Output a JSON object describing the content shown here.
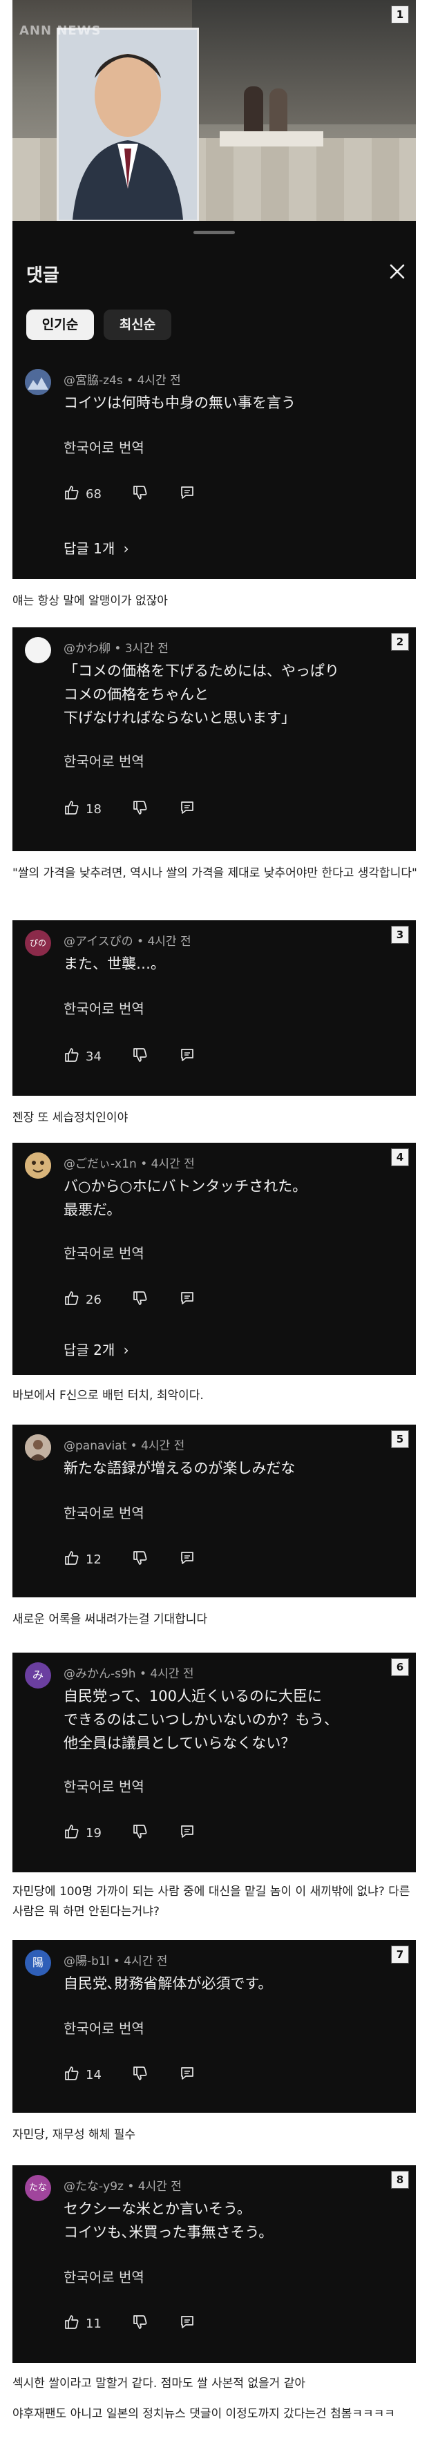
{
  "video": {
    "watermark": "ANN NEWS",
    "badge": "1"
  },
  "comments_panel": {
    "title": "댓글",
    "close_icon": "close-icon",
    "sort_tabs": [
      {
        "label": "인기순",
        "active": true
      },
      {
        "label": "최신순",
        "active": false
      }
    ]
  },
  "comments": [
    {
      "badge": "",
      "author": "@宮脇-z4s • 4시간 전",
      "text_lines": [
        "コイツは何時も中身の無い事を言う"
      ],
      "translate": "한국어로 번역",
      "likes": "68",
      "replies": "답글 1개",
      "caption": "얘는 항상 말에 알맹이가 없잖아"
    },
    {
      "badge": "2",
      "author": "@かわ柳 • 3시간 전",
      "text_lines": [
        "「コメの価格を下げるためには、やっぱり",
        "コメの価格をちゃんと",
        "下げなければならないと思います」"
      ],
      "translate": "한국어로 번역",
      "likes": "18",
      "replies": "",
      "caption": "\"쌀의 가격을 낮추려면, 역시나 쌀의 가격을 제대로 낮추어야만 한다고 생각합니다\""
    },
    {
      "badge": "3",
      "author": "@アイスぴの • 4시간 전",
      "text_lines": [
        "また、世襲…。"
      ],
      "translate": "한국어로 번역",
      "likes": "34",
      "replies": "",
      "caption": "젠장 또 세습정치인이야"
    },
    {
      "badge": "4",
      "author": "@ごだぃ-x1n • 4시간 전",
      "text_lines": [
        "バ○から○ホにバトンタッチされた。",
        "最悪だ。"
      ],
      "translate": "한국어로 번역",
      "likes": "26",
      "replies": "답글 2개",
      "caption": "바보에서 F신으로 배턴 터치, 최악이다."
    },
    {
      "badge": "5",
      "author": "@panaviat • 4시간 전",
      "text_lines": [
        "新たな語録が増えるのが楽しみだな"
      ],
      "translate": "한국어로 번역",
      "likes": "12",
      "replies": "",
      "caption": "새로운 어록을 써내려가는걸 기대합니다"
    },
    {
      "badge": "6",
      "author": "@みかん-s9h • 4시간 전",
      "text_lines": [
        "自民党って、100人近くいるのに大臣に",
        "できるのはこいつしかいないのか？もう、",
        "他全員は議員としていらなくない？"
      ],
      "translate": "한국어로 번역",
      "likes": "19",
      "replies": "",
      "caption": "자민당에 100명 가까이 되는 사람 중에 대신을 맡길 놈이 이 새끼밖에 없냐? 다른 사람은 뭐 하면 안된다는거냐?"
    },
    {
      "badge": "7",
      "author": "@陽-b1l • 4시간 전",
      "text_lines": [
        "自民党､財務省解体が必須です。"
      ],
      "translate": "한국어로 번역",
      "likes": "14",
      "replies": "",
      "caption": "자민당, 재무성 해체 필수"
    },
    {
      "badge": "8",
      "author": "@たな-y9z • 4시간 전",
      "text_lines": [
        "セクシーな米とか言いそう。",
        "コイツも､米買った事無さそう。"
      ],
      "translate": "한국어로 번역",
      "likes": "11",
      "replies": "",
      "caption": "섹시한 쌀이라고 말할거 같다. 점마도 쌀 사본적 없을거 같아"
    }
  ],
  "footer_caption": "야후재팬도 아니고 일본의 정치뉴스 댓글이 이정도까지 갔다는건 첨봄ㅋㅋㅋㅋ",
  "avatar_labels": [
    "",
    "",
    "ぴの",
    "",
    "",
    "み",
    "陽",
    "たな"
  ],
  "colors": {
    "panel_bg": "#0f0f0f",
    "text": "#f1f1f1",
    "meta": "#aaaaaa",
    "page_bg": "#ffffff",
    "caption_text": "#222222"
  }
}
